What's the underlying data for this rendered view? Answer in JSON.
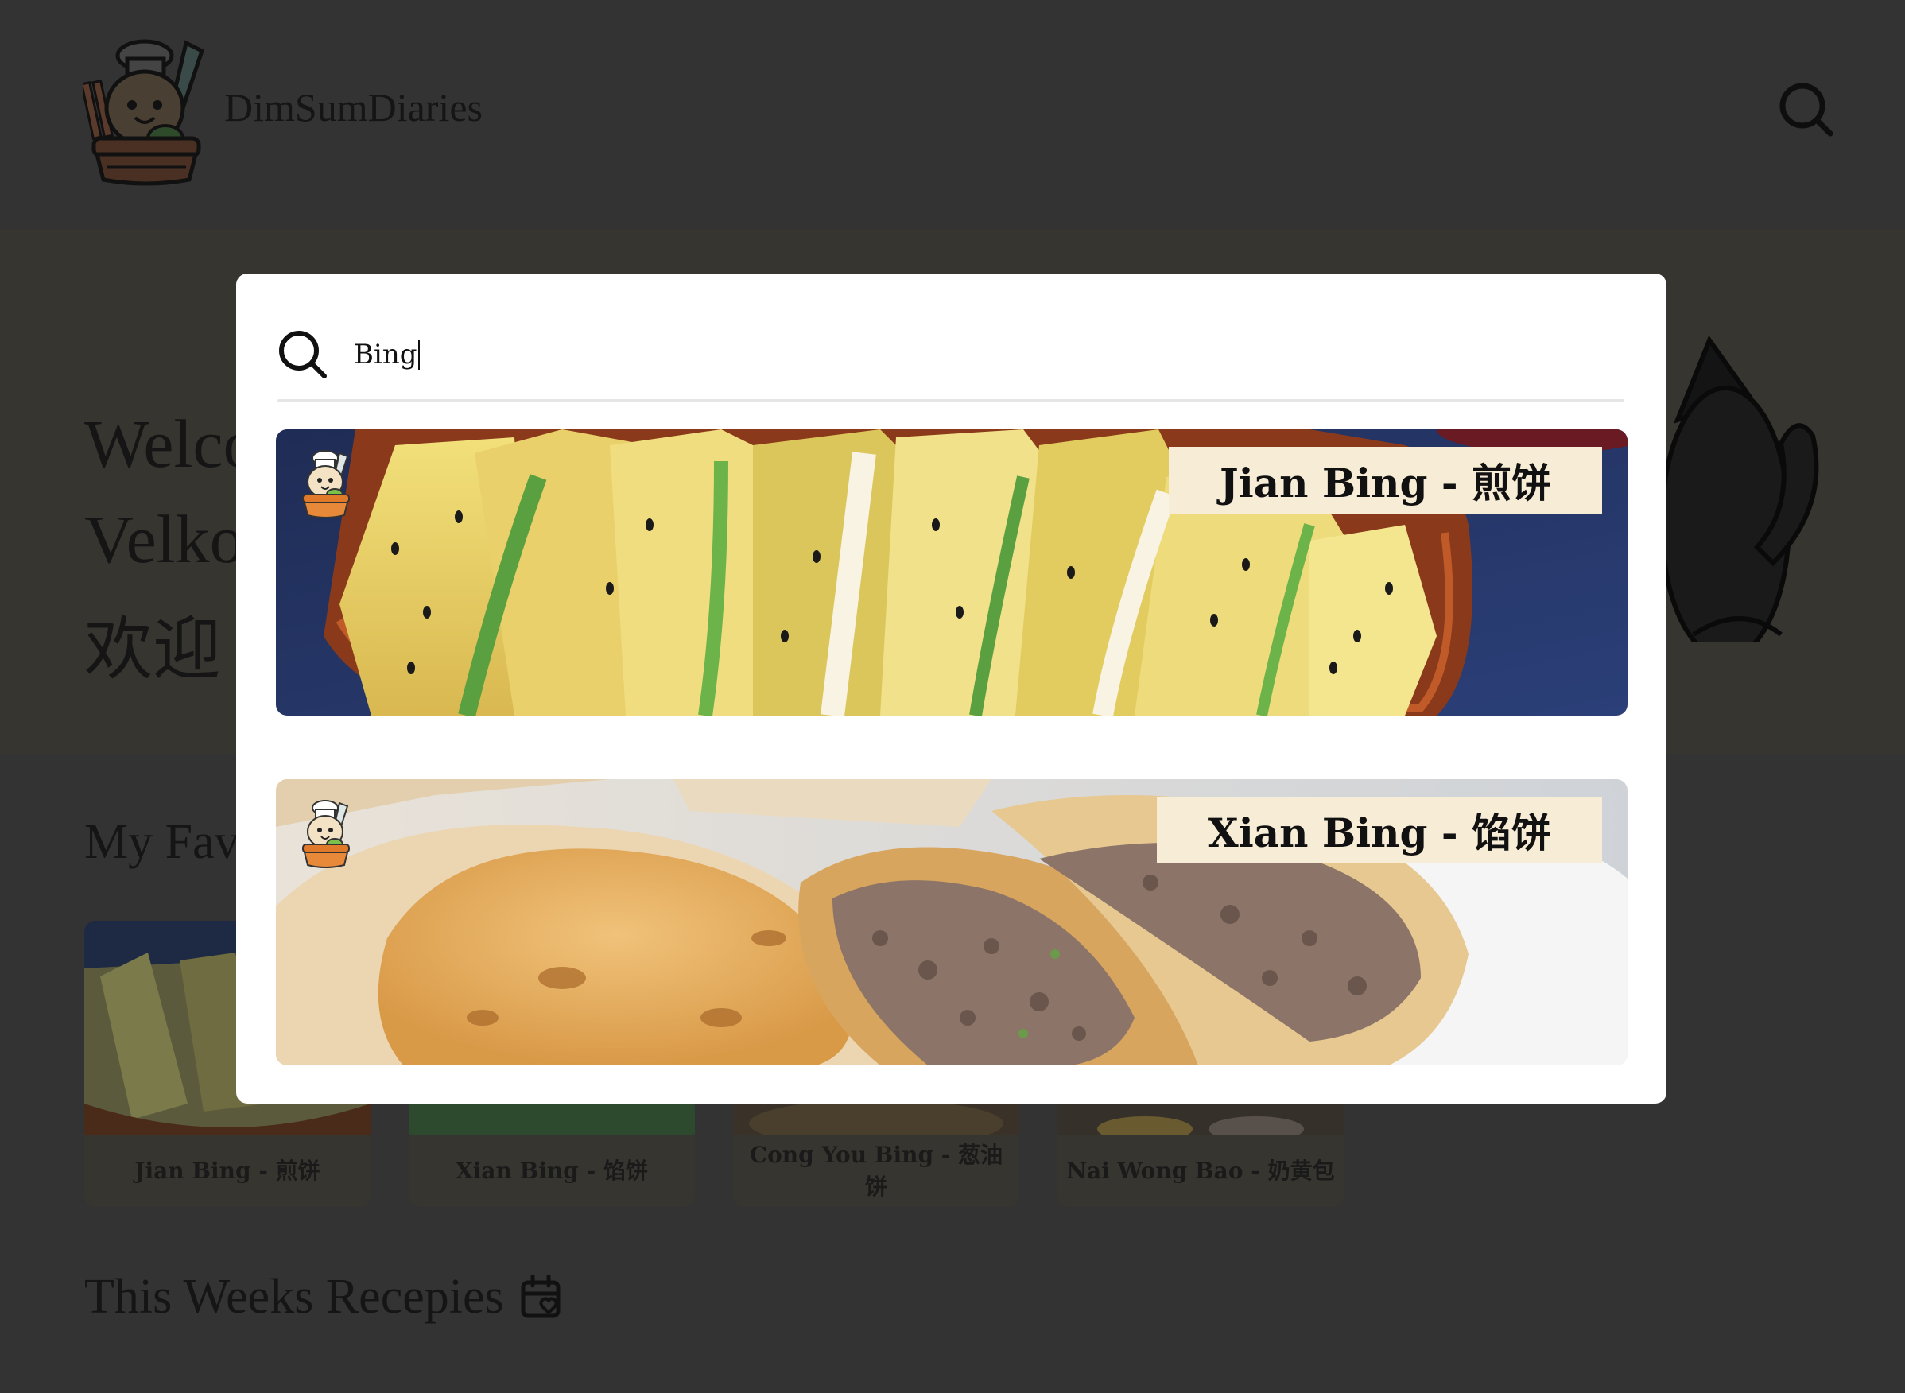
{
  "brand": {
    "name": "DimSumDiaries"
  },
  "hero": {
    "lines": [
      "Welco",
      "Velko",
      "欢迎"
    ]
  },
  "favorites": {
    "title": "My Fav",
    "cards": [
      {
        "label": "Jian Bing - 煎饼"
      },
      {
        "label": "Xian Bing - 馅饼"
      },
      {
        "label": "Cong You Bing - 葱油饼"
      },
      {
        "label": "Nai Wong Bao - 奶黄包"
      }
    ]
  },
  "weekly": {
    "title": "This Weeks Recepies",
    "icon": "calendar-heart-icon"
  },
  "search": {
    "query": "Bing",
    "icon": "search-icon",
    "results": [
      {
        "title": "Jian Bing - 煎饼"
      },
      {
        "title": "Xian Bing - 馅饼"
      }
    ]
  },
  "colors": {
    "background": "#333333",
    "hero_band": "#37352f",
    "modal": "#ffffff",
    "title_label": "#f7edd7"
  }
}
